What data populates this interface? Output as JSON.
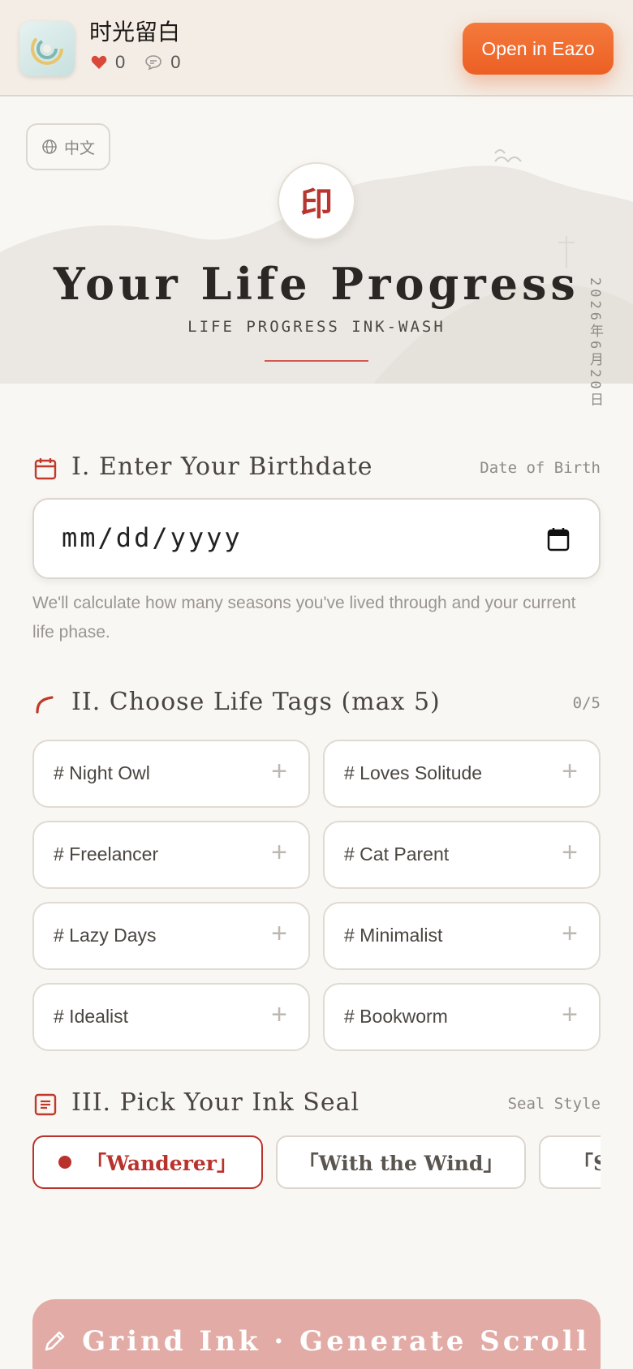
{
  "appbar": {
    "title": "时光留白",
    "likes": "0",
    "comments": "0",
    "open_button": "Open in Eazo"
  },
  "hero": {
    "language_button": "中文",
    "seal_char": "印",
    "title": "Your Life Progress",
    "subtitle": "LIFE PROGRESS INK-WASH",
    "vertical_date": "2026年6月20日"
  },
  "birthdate": {
    "title": "I. Enter Your Birthdate",
    "meta": "Date of Birth",
    "placeholder": "mm/dd/yyyy",
    "hint": "We'll calculate how many seasons you've lived through and your current life phase."
  },
  "tags": {
    "title": "II. Choose Life Tags (max 5)",
    "counter": "0/5",
    "items": [
      {
        "label": "# Night Owl"
      },
      {
        "label": "# Loves Solitude"
      },
      {
        "label": "# Freelancer"
      },
      {
        "label": "# Cat Parent"
      },
      {
        "label": "# Lazy Days"
      },
      {
        "label": "# Minimalist"
      },
      {
        "label": "# Idealist"
      },
      {
        "label": "# Bookworm"
      }
    ],
    "plus_glyph": "+"
  },
  "seal": {
    "title": "III. Pick Your Ink Seal",
    "meta": "Seal Style",
    "options": [
      {
        "label": "「Wanderer」"
      },
      {
        "label": "「With the Wind」"
      },
      {
        "label": "「S"
      }
    ]
  },
  "cta": {
    "label": "Grind Ink · Generate Scroll"
  },
  "colors": {
    "accent": "#b9322b",
    "open_button": "#ec5f24",
    "cta_bg": "#e2aba5"
  }
}
